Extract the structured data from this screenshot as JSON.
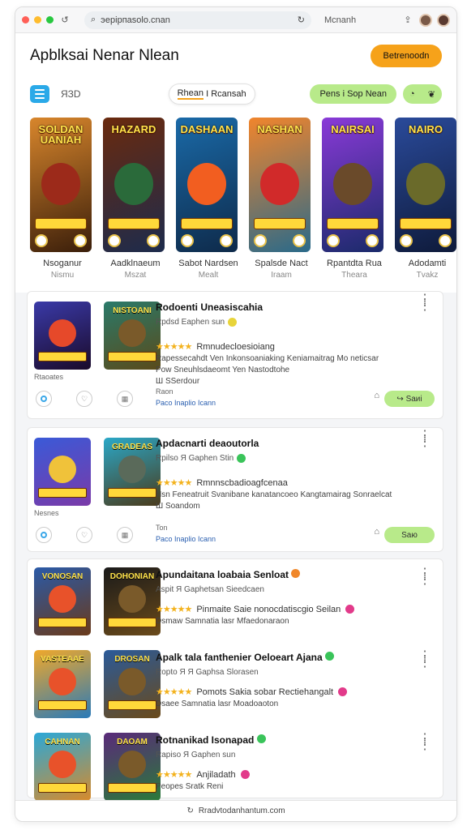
{
  "browser": {
    "url": "эерiрпаsolo.cnan",
    "tab_title": "Mcnanh",
    "colors": {
      "red": "#ff5f57",
      "yellow": "#febc2e",
      "green": "#28c840"
    }
  },
  "header": {
    "title": "Apblksai Nenar Nleаn",
    "cta_label": "Betrenoodn",
    "filter_label": "ЯЗD",
    "segment": {
      "active": "Rhean",
      "rest": "I Rcansah"
    },
    "green_pill": "Pens i Sop Nean"
  },
  "featured": [
    {
      "title": "SOLDAN UANIAH",
      "name": "Nsoganur",
      "sub": "Nismu",
      "bg": "#d8862c",
      "bg2": "#3a1e0a",
      "accent": "#9c2a1a"
    },
    {
      "title": "HAZARD",
      "name": "Aadklnaeum",
      "sub": "Mszat",
      "bg": "#6a2a0e",
      "bg2": "#1d2b4c",
      "accent": "#2a6a3a"
    },
    {
      "title": "DASHAAN",
      "name": "Sabot Nardsen",
      "sub": "Mealt",
      "bg": "#1a6aa8",
      "bg2": "#0e2a4a",
      "accent": "#f25e20"
    },
    {
      "title": "NASHAN",
      "name": "Spalsde Nact",
      "sub": "Iraam",
      "bg": "#f1852c",
      "bg2": "#2a6a8a",
      "accent": "#d12a2a"
    },
    {
      "title": "NAIRSAI",
      "name": "Rpantdta Rua",
      "sub": "Theara",
      "bg": "#8a3ad8",
      "bg2": "#1a2a6a",
      "accent": "#6a4a2a"
    },
    {
      "title": "NAIRO",
      "name": "Adodamti",
      "sub": "Tvakz",
      "bg": "#2a4a9a",
      "bg2": "#0e1a3a",
      "accent": "#6a6a2a"
    }
  ],
  "list1": {
    "title": "Rodoenti Uneasiscahia",
    "meta": "Rpdsd  Eaphen sun",
    "badge_color": "#e8d43a",
    "stars": "★★★★★",
    "desc": "Rmnudecloesioiang",
    "line1": "Rapessecahdt Ven Inkonsoaniaking Keniamaitrag Mo neticsar",
    "line2": "Pow Sneuhlsdaeomt Yen Nastodtohe",
    "line3": "Ш  SSerdour",
    "cap": "Rtaoates",
    "small": "Raon",
    "small2": "Paco Inaplio Icann",
    "btn": "Saиi",
    "thumb1": {
      "title": "",
      "bg": "#3a3aa8",
      "bg2": "#1a0a2a"
    },
    "thumb2": {
      "title": "NISTOANI",
      "bg": "#2a7a6a",
      "bg2": "#5a4a1a"
    }
  },
  "list2": {
    "title": "Apdacnarti deaoutorla",
    "meta": "Rpilsо  Я  Gaphen Stin",
    "badge_color": "#3ac45a",
    "stars": "★★★★★",
    "desc": "Rmnnscbadioagfcenaa",
    "line1": "Nsn Feneatruit Svanibane kanatancoeo Kangtamairag Sonraelcat",
    "line3": "Ш  Soandom",
    "cap": "Nesnes",
    "small": "Ton",
    "small2": "Paco Inaplio Icann",
    "btn": "Saю",
    "thumb1": {
      "title": "",
      "bg": "#3a5ad8",
      "bg2": "#7a3aa8"
    },
    "thumb2": {
      "title": "GRADEAS",
      "bg": "#2aa8c8",
      "bg2": "#4a3a1a"
    }
  },
  "list3": [
    {
      "title": "Apundaitana loabaia Senloat",
      "meta": "Aspit  Я  Gaphetsan  Sieedcaen",
      "tag": "Pinmaite Saie nonocdatiscgio Seilan",
      "line": "Dsmaw  Samnatia lasr  Mfaedonaraon",
      "thumb1": {
        "title": "VONOSAN",
        "bg": "#2a5aa8",
        "bg2": "#6a3a1a"
      },
      "thumb2": {
        "title": "DOHONIAN",
        "bg": "#1a1a1a",
        "bg2": "#6a4a1a"
      },
      "badge": "#f0872a"
    },
    {
      "title": "Apalk tala fanthenier Oeloeart Ajana",
      "meta": "Ropto  Я  Я  Gaphsa  Slorasen",
      "tag": "Pomots Sakia sobar Rectiehangalt",
      "line": "Dsaee  Samnatia lasr  Moadoaoton",
      "thumb1": {
        "title": "VASTEAAE",
        "bg": "#f0a82a",
        "bg2": "#2a7ab8"
      },
      "thumb2": {
        "title": "DROSAN",
        "bg": "#2a5a9a",
        "bg2": "#6a4a1a"
      },
      "badge": "#3ac45a"
    },
    {
      "title": "Rotnanikad  Isonapad",
      "meta": "Rapiso  Я  Gaphen sun",
      "tag": "Anjiladath",
      "line": "Peopes Sratk  Reni",
      "thumb1": {
        "title": "CAHNAN",
        "bg": "#2aa8d8",
        "bg2": "#d88a2a"
      },
      "thumb2": {
        "title": "DAOAM",
        "bg": "#5a2a7a",
        "bg2": "#2a7a3a"
      },
      "badge": "#3ac45a"
    }
  ],
  "footer": {
    "text": "Rradvtodanhantum.com"
  }
}
